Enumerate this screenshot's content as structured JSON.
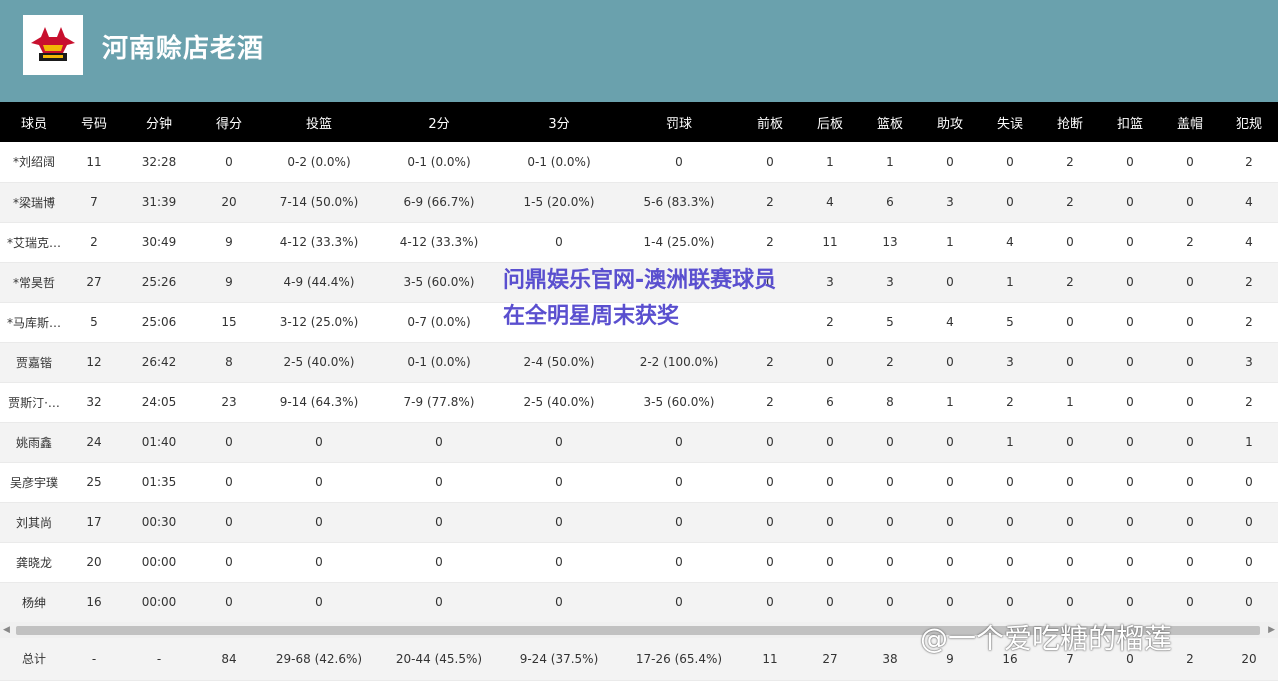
{
  "header": {
    "team_name": "河南赊店老酒",
    "logo_icon": "team-bull-logo-icon",
    "bg_color": "#6aa1ad"
  },
  "columns": [
    "球员",
    "号码",
    "分钟",
    "得分",
    "投篮",
    "2分",
    "3分",
    "罚球",
    "前板",
    "后板",
    "篮板",
    "助攻",
    "失误",
    "抢断",
    "扣篮",
    "盖帽",
    "犯规"
  ],
  "rows": [
    [
      "*刘绍阔",
      "11",
      "32:28",
      "0",
      "0-2 (0.0%)",
      "0-1 (0.0%)",
      "0-1 (0.0%)",
      "0",
      "0",
      "1",
      "1",
      "0",
      "0",
      "2",
      "0",
      "0",
      "2"
    ],
    [
      "*梁瑞博",
      "7",
      "31:39",
      "20",
      "7-14 (50.0%)",
      "6-9 (66.7%)",
      "1-5 (20.0%)",
      "5-6 (83.3%)",
      "2",
      "4",
      "6",
      "3",
      "0",
      "2",
      "0",
      "0",
      "4"
    ],
    [
      "*艾瑞克…",
      "2",
      "30:49",
      "9",
      "4-12 (33.3%)",
      "4-12 (33.3%)",
      "0",
      "1-4 (25.0%)",
      "2",
      "11",
      "13",
      "1",
      "4",
      "0",
      "0",
      "2",
      "4"
    ],
    [
      "*常昊哲",
      "27",
      "25:26",
      "9",
      "4-9 (44.4%)",
      "3-5 (60.0%)",
      "",
      "",
      "0",
      "3",
      "3",
      "0",
      "1",
      "2",
      "0",
      "0",
      "2"
    ],
    [
      "*马库斯…",
      "5",
      "25:06",
      "15",
      "3-12 (25.0%)",
      "0-7 (0.0%)",
      "",
      "",
      "",
      "2",
      "5",
      "4",
      "5",
      "0",
      "0",
      "0",
      "2"
    ],
    [
      "贾嘉锴",
      "12",
      "26:42",
      "8",
      "2-5 (40.0%)",
      "0-1 (0.0%)",
      "2-4 (50.0%)",
      "2-2 (100.0%)",
      "2",
      "0",
      "2",
      "0",
      "3",
      "0",
      "0",
      "0",
      "3"
    ],
    [
      "贾斯汀·…",
      "32",
      "24:05",
      "23",
      "9-14 (64.3%)",
      "7-9 (77.8%)",
      "2-5 (40.0%)",
      "3-5 (60.0%)",
      "2",
      "6",
      "8",
      "1",
      "2",
      "1",
      "0",
      "0",
      "2"
    ],
    [
      "姚雨鑫",
      "24",
      "01:40",
      "0",
      "0",
      "0",
      "0",
      "0",
      "0",
      "0",
      "0",
      "0",
      "1",
      "0",
      "0",
      "0",
      "1"
    ],
    [
      "吴彦宇璞",
      "25",
      "01:35",
      "0",
      "0",
      "0",
      "0",
      "0",
      "0",
      "0",
      "0",
      "0",
      "0",
      "0",
      "0",
      "0",
      "0"
    ],
    [
      "刘其尚",
      "17",
      "00:30",
      "0",
      "0",
      "0",
      "0",
      "0",
      "0",
      "0",
      "0",
      "0",
      "0",
      "0",
      "0",
      "0",
      "0"
    ],
    [
      "龚晓龙",
      "20",
      "00:00",
      "0",
      "0",
      "0",
      "0",
      "0",
      "0",
      "0",
      "0",
      "0",
      "0",
      "0",
      "0",
      "0",
      "0"
    ],
    [
      "杨绅",
      "16",
      "00:00",
      "0",
      "0",
      "0",
      "0",
      "0",
      "0",
      "0",
      "0",
      "0",
      "0",
      "0",
      "0",
      "0",
      "0"
    ]
  ],
  "totals": [
    "总计",
    "-",
    "-",
    "84",
    "29-68 (42.6%)",
    "20-44 (45.5%)",
    "9-24 (37.5%)",
    "17-26 (65.4%)",
    "11",
    "27",
    "38",
    "9",
    "16",
    "7",
    "0",
    "2",
    "20"
  ],
  "overlay_text": "问鼎娱乐官网-澳洲联赛球员在全明星周末获奖",
  "watermark_text": "@一个爱吃糖的榴莲",
  "scrollbar": {
    "left_arrow": "◀",
    "right_arrow": "▶"
  }
}
